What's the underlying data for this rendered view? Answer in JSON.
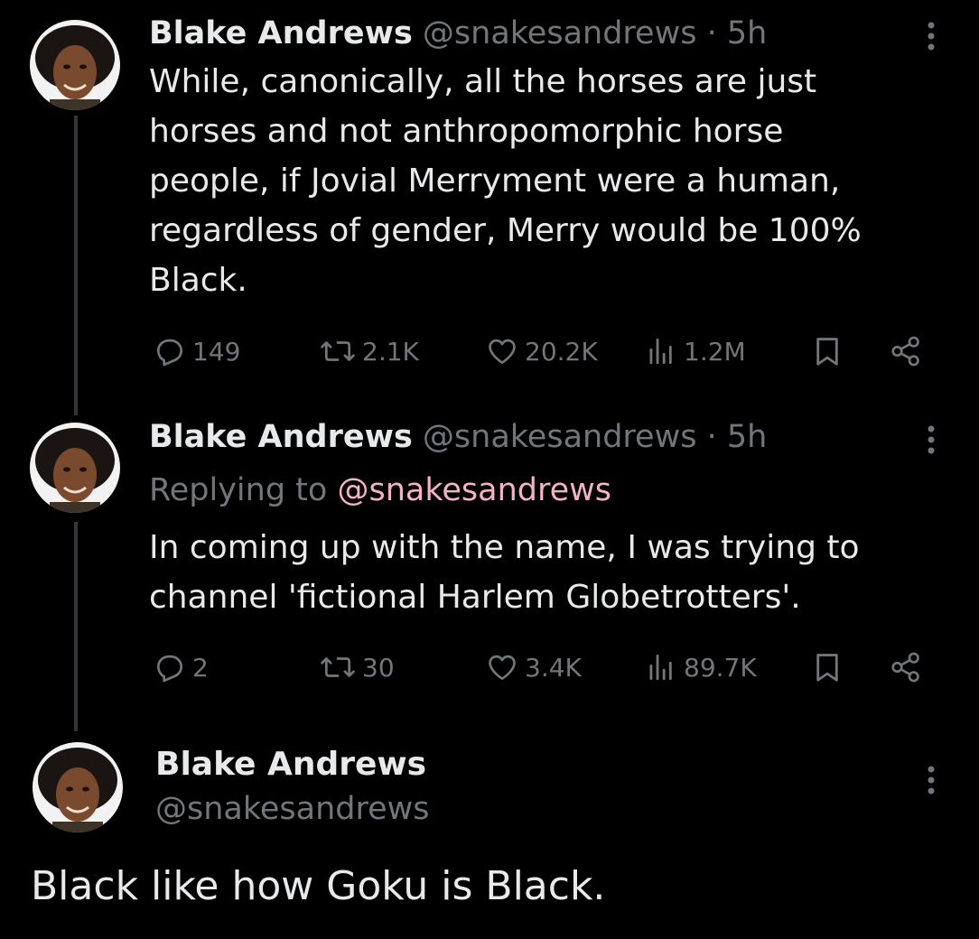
{
  "colors": {
    "background": "#000000",
    "primary_text": "#e7e9ea",
    "secondary_text": "#71767b",
    "mention": "#f4b3c2",
    "thread_line": "#333639"
  },
  "tweets": [
    {
      "author_name": "Blake Andrews",
      "author_handle": "@snakesandrews",
      "separator": "·",
      "time": "5h",
      "text_lines": [
        "While, canonically, all the horses are just",
        "horses and not anthropomorphic horse",
        "people, if Jovial Merryment were a human,",
        "regardless of gender, Merry would be 100%",
        "Black."
      ],
      "reply_count": "149",
      "repost_count": "2.1K",
      "like_count": "20.2K",
      "view_count": "1.2M",
      "icons": [
        "avatar",
        "more-icon",
        "reply-icon",
        "repost-icon",
        "like-icon",
        "views-icon",
        "bookmark-icon",
        "share-icon"
      ]
    },
    {
      "author_name": "Blake Andrews",
      "author_handle": "@snakesandrews",
      "separator": "·",
      "time": "5h",
      "replying_prefix": "Replying to",
      "replying_to": "@snakesandrews",
      "text_lines": [
        "In coming up with the name, I was trying to",
        "channel 'fictional Harlem Globetrotters'."
      ],
      "reply_count": "2",
      "repost_count": "30",
      "like_count": "3.4K",
      "view_count": "89.7K",
      "icons": [
        "avatar",
        "more-icon",
        "reply-icon",
        "repost-icon",
        "like-icon",
        "views-icon",
        "bookmark-icon",
        "share-icon"
      ]
    }
  ],
  "main_tweet": {
    "author_name": "Blake Andrews",
    "author_handle": "@snakesandrews",
    "text": "Black like how Goku is Black.",
    "icons": [
      "avatar",
      "more-icon"
    ]
  }
}
